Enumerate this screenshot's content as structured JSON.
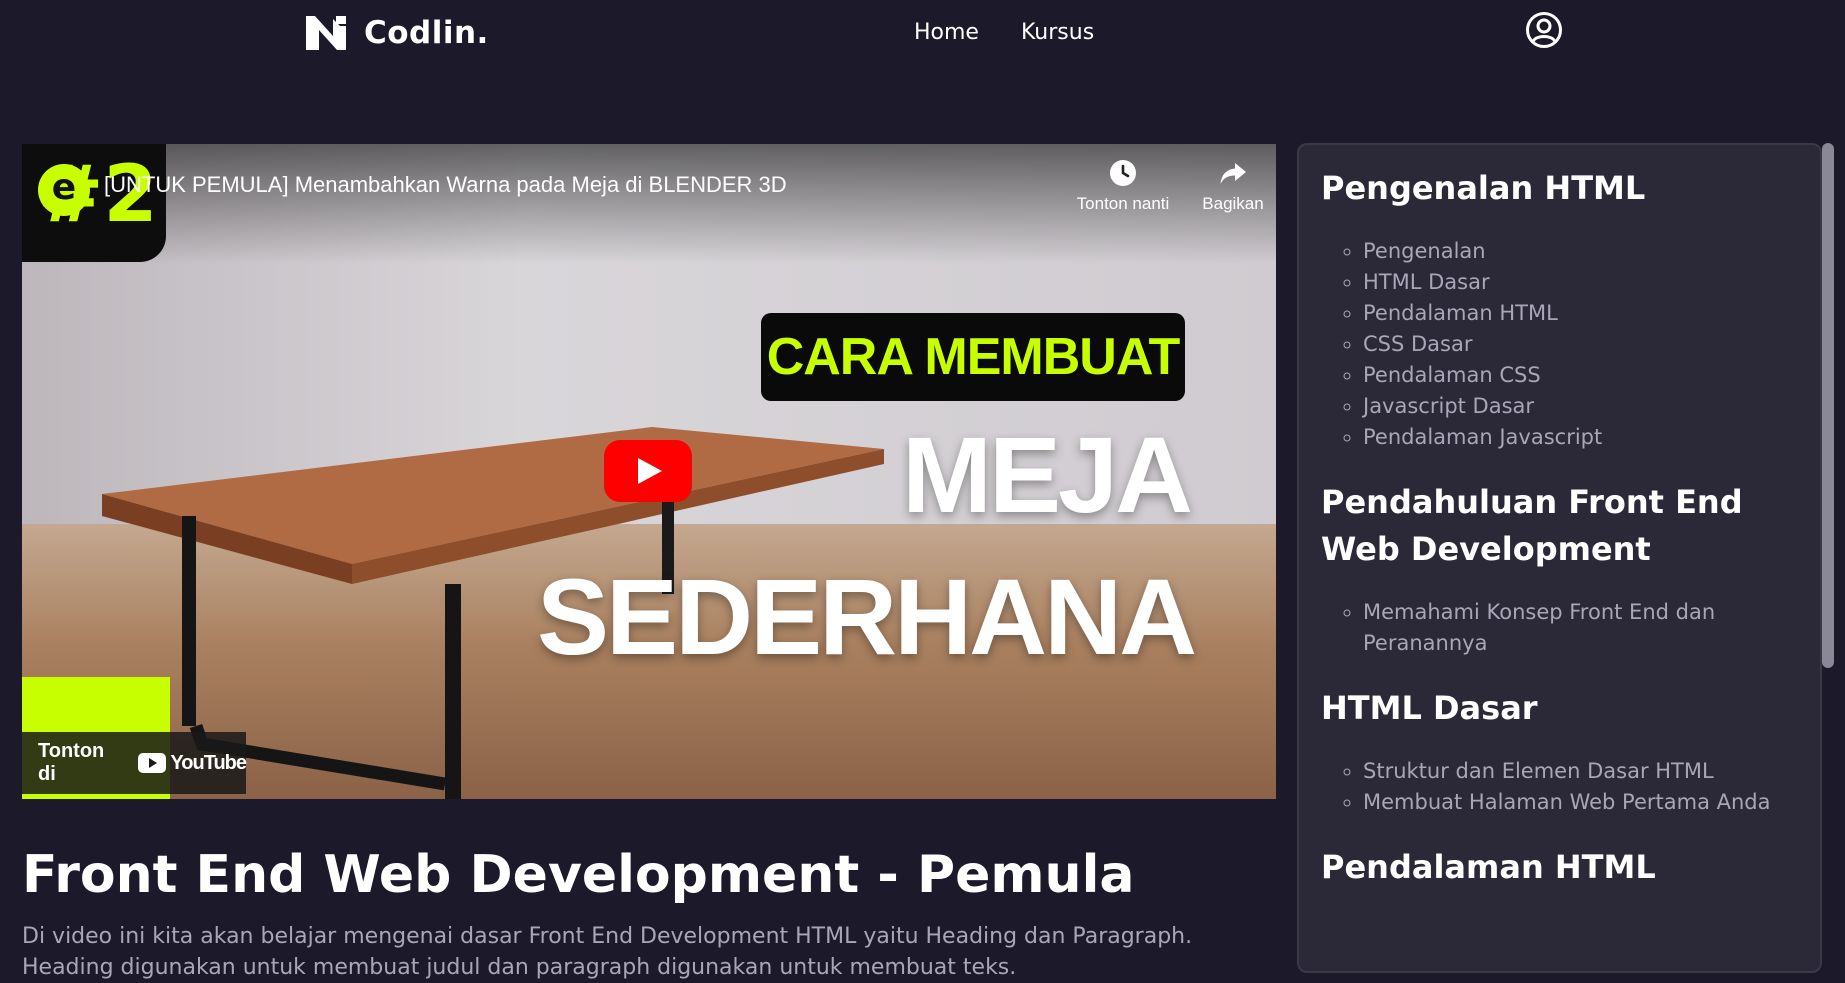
{
  "brand": {
    "name": "Codlin."
  },
  "nav": {
    "links": [
      "Home",
      "Kursus"
    ]
  },
  "video": {
    "title": "[UNTUK PEMULA] Menambahkan Warna pada Meja di BLENDER 3D",
    "badge_number": "#2",
    "watch_later_label": "Tonton nanti",
    "share_label": "Bagikan",
    "thumbnail_label": "CARA MEMBUAT",
    "thumbnail_word_1": "MEJA",
    "thumbnail_word_2": "SEDERHANA",
    "watch_on_label": "Tonton di",
    "youtube_label": "YouTube"
  },
  "course": {
    "title": "Front End Web Development - Pemula",
    "description": "Di video ini kita akan belajar mengenai dasar Front End Development HTML yaitu Heading dan Paragraph. Heading digunakan untuk membuat judul dan paragraph digunakan untuk membuat teks."
  },
  "sidebar": {
    "sections": [
      {
        "title": "Pengenalan HTML",
        "items": [
          "Pengenalan",
          "HTML Dasar",
          "Pendalaman HTML",
          "CSS Dasar",
          "Pendalaman CSS",
          "Javascript Dasar",
          "Pendalaman Javascript"
        ]
      },
      {
        "title": "Pendahuluan Front End Web Development",
        "items": [
          "Memahami Konsep Front End dan Peranannya"
        ]
      },
      {
        "title": "HTML Dasar",
        "items": [
          "Struktur dan Elemen Dasar HTML",
          "Membuat Halaman Web Pertama Anda"
        ]
      },
      {
        "title": "Pendalaman HTML",
        "items": []
      }
    ]
  },
  "colors": {
    "background": "#1c1a2a",
    "sidebar": "#2b2838",
    "accent_green": "#c8ff00",
    "youtube_red": "#ff0000",
    "muted_text": "#a9a6b8"
  }
}
